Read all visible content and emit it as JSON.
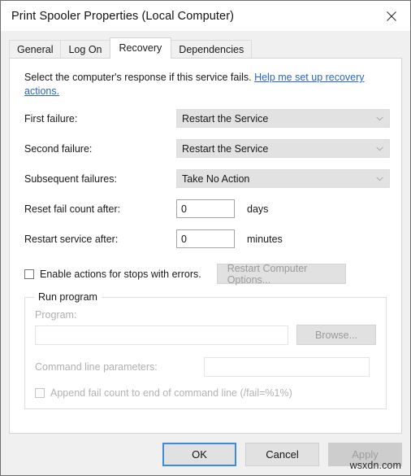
{
  "window": {
    "title": "Print Spooler Properties (Local Computer)",
    "close_icon": "close-icon"
  },
  "tabs": [
    {
      "label": "General",
      "active": false
    },
    {
      "label": "Log On",
      "active": false
    },
    {
      "label": "Recovery",
      "active": true
    },
    {
      "label": "Dependencies",
      "active": false
    }
  ],
  "recovery": {
    "description": "Select the computer's response if this service fails.",
    "help_link": "Help me set up recovery actions.",
    "rows": [
      {
        "label": "First failure:",
        "value": "Restart the Service"
      },
      {
        "label": "Second failure:",
        "value": "Restart the Service"
      },
      {
        "label": "Subsequent failures:",
        "value": "Take No Action"
      }
    ],
    "reset_fail_count": {
      "label": "Reset fail count after:",
      "value": "0",
      "unit": "days"
    },
    "restart_service_after": {
      "label": "Restart service after:",
      "value": "0",
      "unit": "minutes"
    },
    "enable_actions": {
      "label": "Enable actions for stops with errors.",
      "checked": false
    },
    "restart_computer_options_button": "Restart Computer Options...",
    "run_program": {
      "legend": "Run program",
      "program_label": "Program:",
      "program_value": "",
      "browse_button": "Browse...",
      "command_line_label": "Command line parameters:",
      "command_line_value": "",
      "append_fail_count": {
        "label": "Append fail count to end of command line (/fail=%1%)",
        "checked": false
      }
    }
  },
  "footer": {
    "ok": "OK",
    "cancel": "Cancel",
    "apply": "Apply"
  },
  "watermark": "wsxdn.com",
  "colors": {
    "link": "#2a66c8",
    "focus_border": "#3a8dde",
    "panel_bg": "#ffffff",
    "window_bg": "#f0f0f0"
  }
}
